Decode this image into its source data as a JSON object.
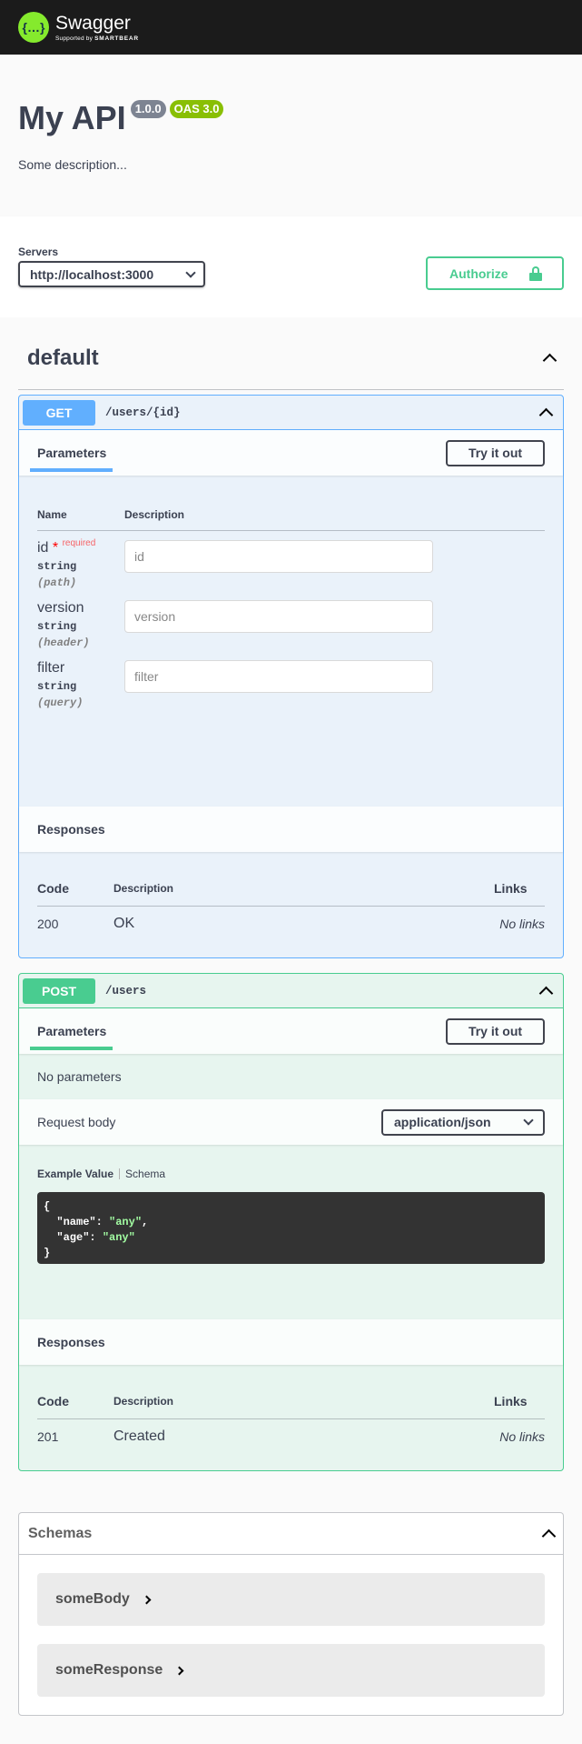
{
  "topbar": {
    "logo_glyph": "{…}",
    "brand": "Swagger",
    "supported_by": "Supported by",
    "smartbear": "SMARTBEAR"
  },
  "info": {
    "title": "My API",
    "version": "1.0.0",
    "oas": "OAS 3.0",
    "description": "Some description..."
  },
  "servers": {
    "label": "Servers",
    "selected": "http://localhost:3000"
  },
  "authorize": {
    "label": "Authorize"
  },
  "tag": {
    "name": "default"
  },
  "operations": [
    {
      "method": "GET",
      "path": "/users/{id}",
      "parameters_tab": "Parameters",
      "try_label": "Try it out",
      "params_header": {
        "name": "Name",
        "description": "Description"
      },
      "params": [
        {
          "name": "id",
          "star": "*",
          "required": "required",
          "type": "string",
          "in": "(path)",
          "placeholder": "id"
        },
        {
          "name": "version",
          "type": "string",
          "in": "(header)",
          "placeholder": "version"
        },
        {
          "name": "filter",
          "type": "string",
          "in": "(query)",
          "placeholder": "filter"
        }
      ],
      "responses_title": "Responses",
      "responses_header": {
        "code": "Code",
        "description": "Description",
        "links": "Links"
      },
      "responses": [
        {
          "code": "200",
          "description": "OK",
          "links": "No links"
        }
      ]
    },
    {
      "method": "POST",
      "path": "/users",
      "parameters_tab": "Parameters",
      "try_label": "Try it out",
      "no_params": "No parameters",
      "request_body_label": "Request body",
      "content_type": "application/json",
      "example_tab": "Example Value",
      "schema_tab": "Schema",
      "example_lines": [
        "{",
        "  \"name\": \"any\",",
        "  \"age\": \"any\"",
        "}"
      ],
      "responses_title": "Responses",
      "responses_header": {
        "code": "Code",
        "description": "Description",
        "links": "Links"
      },
      "responses": [
        {
          "code": "201",
          "description": "Created",
          "links": "No links"
        }
      ]
    }
  ],
  "schemas": {
    "title": "Schemas",
    "models": [
      "someBody",
      "someResponse"
    ]
  },
  "colors": {
    "get": "#61affe",
    "post": "#49cc90",
    "brand_green": "#85ea2d"
  }
}
